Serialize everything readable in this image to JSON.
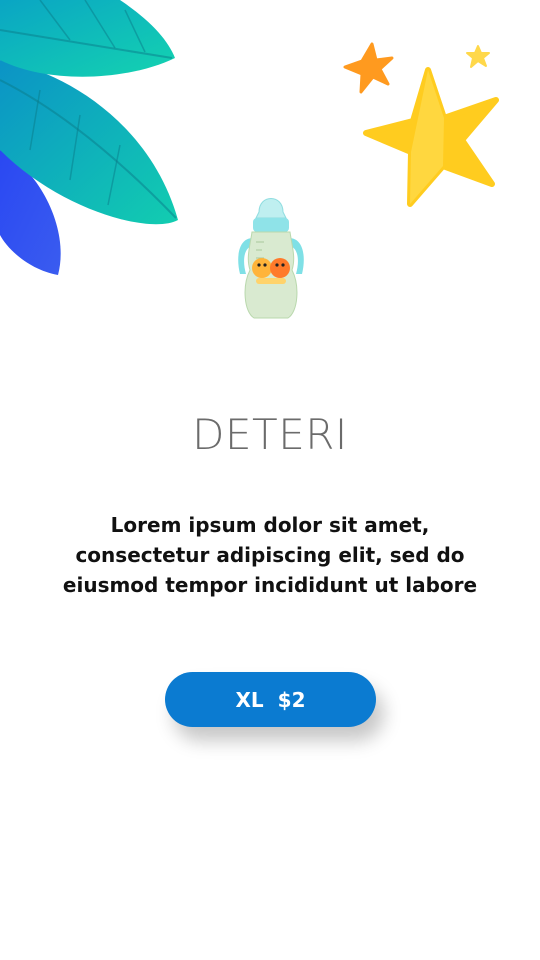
{
  "product": {
    "name": "DETERI",
    "description": "Lorem ipsum dolor sit amet, consectetur adipiscing elit, sed do eiusmod tempor incididunt ut labore",
    "image_icon": "baby-bottle-icon"
  },
  "price_button": {
    "size": "XL",
    "price": "$2"
  },
  "decorations": {
    "leaves_icon": "leaves-icon",
    "stars_icon": "stars-icon"
  },
  "colors": {
    "accent": "#0b7bd1",
    "title": "#6b6b6b",
    "text": "#111111",
    "star_yellow": "#ffcc1f",
    "star_orange": "#ff9a1f",
    "leaf_teal": "#16c4b4",
    "leaf_blue": "#3a4cf0"
  }
}
